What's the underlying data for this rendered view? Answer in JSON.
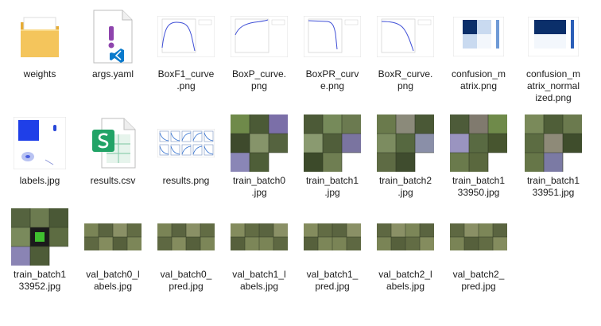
{
  "files": [
    {
      "name": "weights",
      "label": "weights",
      "icon": "folder-icon"
    },
    {
      "name": "args-yaml",
      "label": "args.yaml",
      "icon": "yaml-file-icon"
    },
    {
      "name": "boxf1-curve-png",
      "label": "BoxF1_curve\n.png",
      "icon": "f1-curve-thumbnail"
    },
    {
      "name": "boxp-curve-png",
      "label": "BoxP_curve.\npng",
      "icon": "p-curve-thumbnail"
    },
    {
      "name": "boxpr-curve-png",
      "label": "BoxPR_curv\ne.png",
      "icon": "pr-curve-thumbnail"
    },
    {
      "name": "boxr-curve-png",
      "label": "BoxR_curve.\npng",
      "icon": "r-curve-thumbnail"
    },
    {
      "name": "confusion-matrix-png",
      "label": "confusion_m\natrix.png",
      "icon": "confusion-matrix-thumbnail"
    },
    {
      "name": "confusion-matrix-normalized-png",
      "label": "confusion_m\natrix_normal\nized.png",
      "icon": "confusion-matrix-normalized-thumbnail"
    },
    {
      "name": "labels-jpg",
      "label": "labels.jpg",
      "icon": "labels-thumbnail"
    },
    {
      "name": "results-csv",
      "label": "results.csv",
      "icon": "excel-csv-icon"
    },
    {
      "name": "results-png",
      "label": "results.png",
      "icon": "results-plots-thumbnail"
    },
    {
      "name": "train-batch0-jpg",
      "label": "train_batch0\n.jpg",
      "icon": "image-grid-thumbnail"
    },
    {
      "name": "train-batch1-jpg",
      "label": "train_batch1\n.jpg",
      "icon": "image-grid-thumbnail"
    },
    {
      "name": "train-batch2-jpg",
      "label": "train_batch2\n.jpg",
      "icon": "image-grid-thumbnail"
    },
    {
      "name": "train-batch133950-jpg",
      "label": "train_batch1\n33950.jpg",
      "icon": "image-grid-thumbnail"
    },
    {
      "name": "train-batch133951-jpg",
      "label": "train_batch1\n33951.jpg",
      "icon": "image-grid-thumbnail"
    },
    {
      "name": "train-batch133952-jpg",
      "label": "train_batch1\n33952.jpg",
      "icon": "image-grid-thumbnail"
    },
    {
      "name": "val-batch0-labels-jpg",
      "label": "val_batch0_l\nabels.jpg",
      "icon": "image-strip-thumbnail"
    },
    {
      "name": "val-batch0-pred-jpg",
      "label": "val_batch0_\npred.jpg",
      "icon": "image-strip-thumbnail"
    },
    {
      "name": "val-batch1-labels-jpg",
      "label": "val_batch1_l\nabels.jpg",
      "icon": "image-strip-thumbnail"
    },
    {
      "name": "val-batch1-pred-jpg",
      "label": "val_batch1_\npred.jpg",
      "icon": "image-strip-thumbnail"
    },
    {
      "name": "val-batch2-labels-jpg",
      "label": "val_batch2_l\nabels.jpg",
      "icon": "image-strip-thumbnail"
    },
    {
      "name": "val-batch2-pred-jpg",
      "label": "val_batch2_\npred.jpg",
      "icon": "image-strip-thumbnail"
    }
  ],
  "colors": {
    "folder": "#f4c55c",
    "folder_dark": "#e6ac35",
    "excel_green": "#21a366",
    "yaml_purple": "#8e44ad",
    "vscode_blue": "#0a7acc",
    "curve_blue": "#3f4fd6",
    "cm_dark": "#0b2f6a",
    "cm_light": "#c9daf0"
  }
}
